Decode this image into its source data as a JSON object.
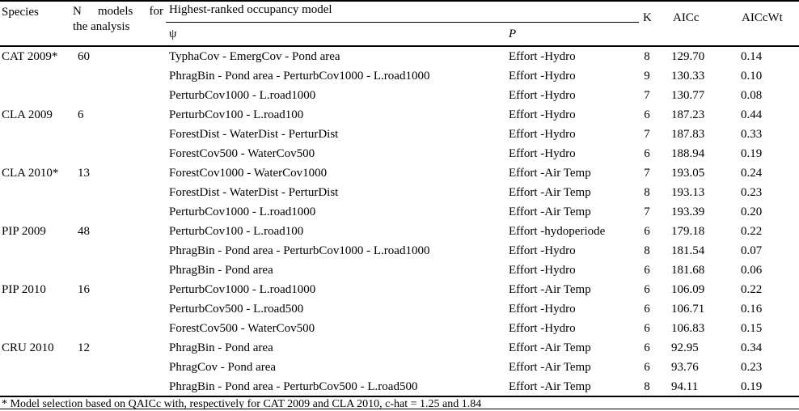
{
  "table": {
    "headers": {
      "species": "Species",
      "n_models_line1": "N  models  for",
      "n_models_line2": "the analysis",
      "occupancy_group": "Highest-ranked occupancy model",
      "psi": "ψ",
      "p": "P",
      "k": "K",
      "aicc": "AICc",
      "aiccwt": "AICcWt"
    },
    "rows": [
      {
        "species": "CAT 2009*",
        "n_models": "60",
        "psi": "TyphaCov -  EmergCov - Pond area",
        "p": "Effort -Hydro",
        "k": "8",
        "aicc": "129.70",
        "aiccwt": "0.14"
      },
      {
        "species": "",
        "n_models": "",
        "psi": "PhragBin - Pond area - PerturbCov1000 - L.road1000",
        "p": "Effort -Hydro",
        "k": "9",
        "aicc": "130.33",
        "aiccwt": "0.10"
      },
      {
        "species": "",
        "n_models": "",
        "psi": "PerturbCov1000 - L.road1000",
        "p": "Effort -Hydro",
        "k": "7",
        "aicc": "130.77",
        "aiccwt": "0.08"
      },
      {
        "species": "CLA 2009",
        "n_models": "6",
        "psi": "PerturbCov100 - L.road100",
        "p": "Effort -Hydro",
        "k": "6",
        "aicc": "187.23",
        "aiccwt": "0.44"
      },
      {
        "species": "",
        "n_models": "",
        "psi": "ForestDist - WaterDist - PerturDist",
        "p": "Effort -Hydro",
        "k": "7",
        "aicc": "187.83",
        "aiccwt": "0.33"
      },
      {
        "species": "",
        "n_models": "",
        "psi": "ForestCov500 - WaterCov500",
        "p": "Effort -Hydro",
        "k": "6",
        "aicc": "188.94",
        "aiccwt": "0.19"
      },
      {
        "species": "CLA 2010*",
        "n_models": "13",
        "psi": "ForestCov1000 - WaterCov1000",
        "p": "Effort -Air Temp",
        "k": "7",
        "aicc": "193.05",
        "aiccwt": "0.24"
      },
      {
        "species": "",
        "n_models": "",
        "psi": "ForestDist - WaterDist - PerturDist",
        "p": "Effort -Air Temp",
        "k": "8",
        "aicc": "193.13",
        "aiccwt": "0.23"
      },
      {
        "species": "",
        "n_models": "",
        "psi": "PerturbCov1000 - L.road1000",
        "p": "Effort -Air Temp",
        "k": "7",
        "aicc": "193.39",
        "aiccwt": "0.20"
      },
      {
        "species": "PIP 2009",
        "n_models": "48",
        "psi": "PerturbCov100 - L.road100",
        "p": "Effort -hydoperiode",
        "k": "6",
        "aicc": "179.18",
        "aiccwt": "0.22"
      },
      {
        "species": "",
        "n_models": "",
        "psi": "PhragBin - Pond area - PerturbCov1000 - L.road1000",
        "p": "Effort -Hydro",
        "k": "8",
        "aicc": "181.54",
        "aiccwt": "0.07"
      },
      {
        "species": "",
        "n_models": "",
        "psi": "PhragBin - Pond area",
        "p": "Effort -Hydro",
        "k": "6",
        "aicc": "181.68",
        "aiccwt": "0.06"
      },
      {
        "species": "PIP 2010",
        "n_models": "16",
        "psi": "PerturbCov1000 - L.road1000",
        "p": "Effort -Air Temp",
        "k": "6",
        "aicc": "106.09",
        "aiccwt": "0.22"
      },
      {
        "species": "",
        "n_models": "",
        "psi": "PerturbCov500 - L.road500",
        "p": "Effort -Hydro",
        "k": "6",
        "aicc": "106.71",
        "aiccwt": "0.16"
      },
      {
        "species": "",
        "n_models": "",
        "psi": "ForestCov500 - WaterCov500",
        "p": "Effort -Hydro",
        "k": "6",
        "aicc": "106.83",
        "aiccwt": "0.15"
      },
      {
        "species": "CRU 2010",
        "n_models": "12",
        "psi": "PhragBin - Pond area",
        "p": "Effort -Air Temp",
        "k": "6",
        "aicc": "92.95",
        "aiccwt": "0.34"
      },
      {
        "species": "",
        "n_models": "",
        "psi": "PhragCov - Pond area",
        "p": "Effort -Air Temp",
        "k": "6",
        "aicc": "93.76",
        "aiccwt": "0.23"
      },
      {
        "species": "",
        "n_models": "",
        "psi": "PhragBin - Pond area - PerturbCov500 - L.road500",
        "p": "Effort -Air Temp",
        "k": "8",
        "aicc": "94.11",
        "aiccwt": "0.19"
      }
    ],
    "footnote": "* Model selection based on QAICc with, respectively for CAT 2009 and CLA 2010, c-hat = 1.25 and 1.84"
  }
}
